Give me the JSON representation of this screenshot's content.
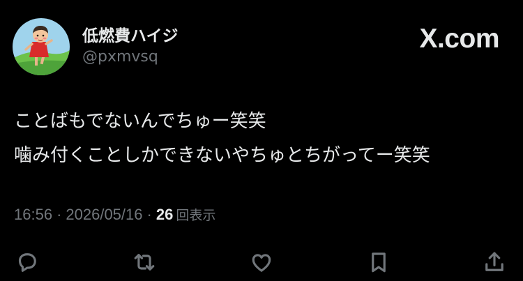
{
  "header": {
    "display_name": "低燃費ハイジ",
    "handle": "@pxmvsq",
    "brand": "X.com",
    "avatar_icon": "avatar-girl-on-hill-icon"
  },
  "tweet": {
    "lines": [
      "ことばもでないんでちゅー笑笑",
      "噛み付くことしかできないやちゅとちがってー笑笑"
    ]
  },
  "meta": {
    "time": "16:56",
    "date": "2026/05/16",
    "separator": "·",
    "views_count": "26",
    "views_label": "回表示"
  },
  "actions": {
    "reply_icon": "reply-icon",
    "retweet_icon": "retweet-icon",
    "like_icon": "like-icon",
    "bookmark_icon": "bookmark-icon",
    "share_icon": "share-icon"
  },
  "colors": {
    "background": "#000000",
    "primary_text": "#e7e9ea",
    "secondary_text": "#71767b",
    "avatar_sky": "#9fd3ec",
    "avatar_grass": "#6cc24a",
    "avatar_dress": "#d92b2b"
  }
}
